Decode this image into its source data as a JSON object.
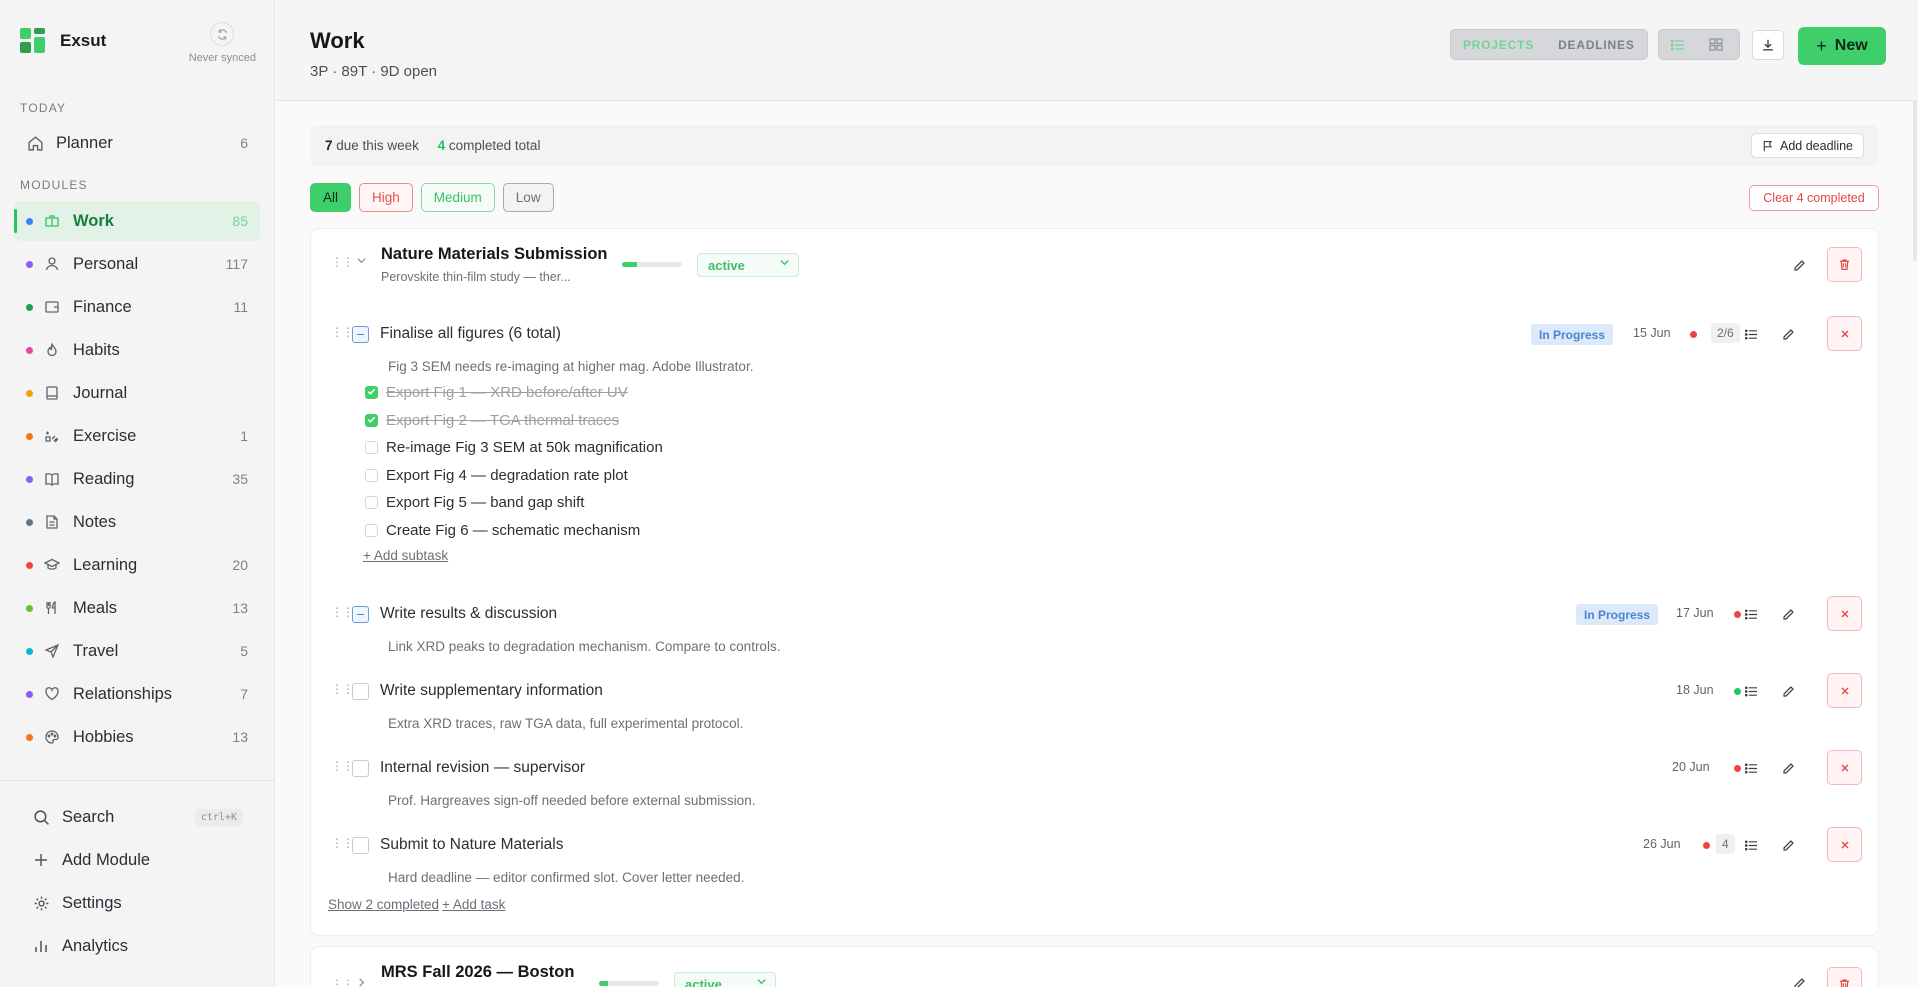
{
  "app": {
    "name": "Exsut",
    "sync_status": "Never synced"
  },
  "sidebar": {
    "today_label": "TODAY",
    "modules_label": "MODULES",
    "planner": {
      "label": "Planner",
      "count": "6"
    },
    "modules": [
      {
        "label": "Work",
        "count": "85",
        "dot": "#3b82f6",
        "icon": "briefcase-icon"
      },
      {
        "label": "Personal",
        "count": "117",
        "dot": "#8b5cf6",
        "icon": "user-icon"
      },
      {
        "label": "Finance",
        "count": "11",
        "dot": "#16a34a",
        "icon": "wallet-icon"
      },
      {
        "label": "Habits",
        "count": "",
        "dot": "#ec4899",
        "icon": "flame-icon"
      },
      {
        "label": "Journal",
        "count": "",
        "dot": "#f59e0b",
        "icon": "journal-icon"
      },
      {
        "label": "Exercise",
        "count": "1",
        "dot": "#f97316",
        "icon": "exercise-icon"
      },
      {
        "label": "Reading",
        "count": "35",
        "dot": "#8b5cf6",
        "icon": "book-icon"
      },
      {
        "label": "Notes",
        "count": "",
        "dot": "#64748b",
        "icon": "note-icon"
      },
      {
        "label": "Learning",
        "count": "20",
        "dot": "#ef4444",
        "icon": "graduation-cap-icon"
      },
      {
        "label": "Meals",
        "count": "13",
        "dot": "#65c32a",
        "icon": "utensils-icon"
      },
      {
        "label": "Travel",
        "count": "5",
        "dot": "#06b6d4",
        "icon": "plane-icon"
      },
      {
        "label": "Relationships",
        "count": "7",
        "dot": "#8b5cf6",
        "icon": "heart-icon"
      },
      {
        "label": "Hobbies",
        "count": "13",
        "dot": "#f97316",
        "icon": "palette-icon"
      }
    ],
    "bottom": {
      "search": "Search",
      "search_shortcut": "ctrl+K",
      "add_module": "Add Module",
      "settings": "Settings",
      "analytics": "Analytics"
    }
  },
  "header": {
    "title": "Work",
    "subtitle": "3P · 89T · 9D open",
    "view_projects": "PROJECTS",
    "view_deadlines": "DEADLINES",
    "new_label": "New"
  },
  "summary": {
    "due_count": "7",
    "due_text": "due this week",
    "completed_count": "4",
    "completed_text": "completed total",
    "add_deadline": "Add deadline"
  },
  "filters": {
    "all": "All",
    "high": "High",
    "medium": "Medium",
    "low": "Low",
    "clear": "Clear 4 completed"
  },
  "project": {
    "title": "Nature Materials Submission",
    "description": "Perovskite thin-film study — ther...",
    "progress": 0.25,
    "status": "active",
    "tasks": [
      {
        "title": "Finalise all figures (6 total)",
        "note": "Fig 3 SEM needs re-imaging at higher mag. Adobe Illustrator.",
        "badge": "In Progress",
        "date": "15 Jun",
        "count": "2/6",
        "priority_color": "#ef4444",
        "subtasks": [
          {
            "text": "Export Fig 1 — XRD before/after UV",
            "done": true
          },
          {
            "text": "Export Fig 2 — TGA thermal traces",
            "done": true
          },
          {
            "text": "Re-image Fig 3 SEM at 50k magnification",
            "done": false
          },
          {
            "text": "Export Fig 4 — degradation rate plot",
            "done": false
          },
          {
            "text": "Export Fig 5 — band gap shift",
            "done": false
          },
          {
            "text": "Create Fig 6 — schematic mechanism",
            "done": false
          }
        ],
        "add_subtask": "+ Add subtask"
      },
      {
        "title": "Write results & discussion",
        "note": "Link XRD peaks to degradation mechanism. Compare to controls.",
        "badge": "In Progress",
        "date": "17 Jun",
        "priority_color": "#ef4444"
      },
      {
        "title": "Write supplementary information",
        "note": "Extra XRD traces, raw TGA data, full experimental protocol.",
        "date": "18 Jun",
        "priority_color": "#22c55e"
      },
      {
        "title": "Internal revision — supervisor",
        "note": "Prof. Hargreaves sign-off needed before external submission.",
        "date": "20 Jun",
        "priority_color": "#ef4444"
      },
      {
        "title": "Submit to Nature Materials",
        "note": "Hard deadline — editor confirmed slot. Cover letter needed.",
        "date": "26 Jun",
        "count": "4",
        "priority_color": "#ef4444"
      }
    ],
    "show_completed": "Show 2 completed",
    "add_task": "+ Add task"
  },
  "project2": {
    "title": "MRS Fall 2026 — Boston",
    "progress": 0.15,
    "status": "active"
  }
}
